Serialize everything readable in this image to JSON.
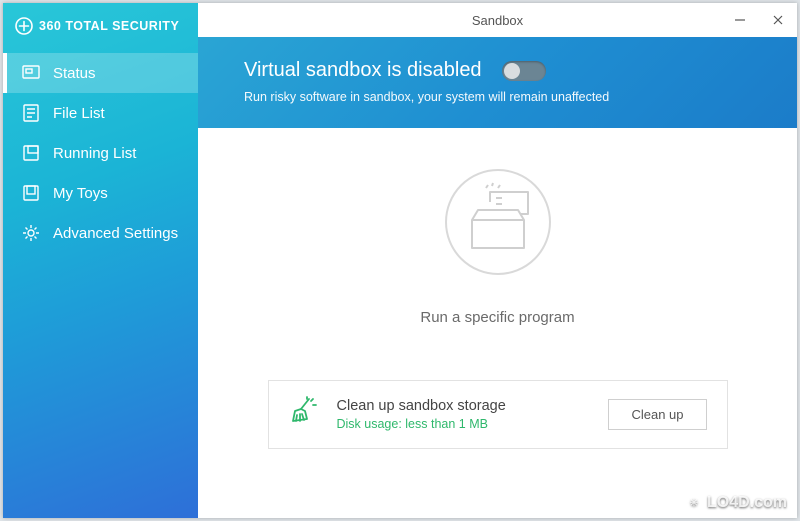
{
  "brand": {
    "name": "360 TOTAL SECURITY"
  },
  "window": {
    "title": "Sandbox"
  },
  "sidebar": {
    "items": [
      {
        "label": "Status",
        "icon": "status-icon",
        "active": true
      },
      {
        "label": "File List",
        "icon": "file-list-icon"
      },
      {
        "label": "Running List",
        "icon": "running-list-icon"
      },
      {
        "label": "My Toys",
        "icon": "my-toys-icon"
      },
      {
        "label": "Advanced Settings",
        "icon": "settings-icon"
      }
    ]
  },
  "hero": {
    "title": "Virtual sandbox is disabled",
    "subtitle": "Run risky software in sandbox, your system will remain unaffected",
    "toggle_state": "off"
  },
  "content": {
    "run_label": "Run a specific program"
  },
  "cleanup": {
    "title": "Clean up sandbox storage",
    "subtitle": "Disk usage: less than 1 MB",
    "button": "Clean up"
  },
  "watermark": "LO4D.com"
}
